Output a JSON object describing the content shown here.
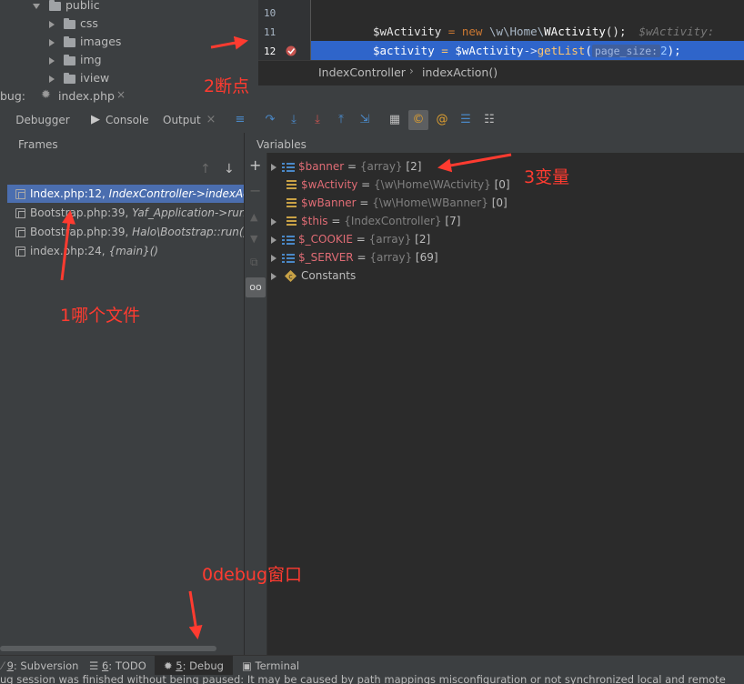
{
  "project_tree": {
    "items": [
      {
        "label": "public",
        "expanded": true
      },
      {
        "label": "css"
      },
      {
        "label": "images"
      },
      {
        "label": "img"
      },
      {
        "label": "iview"
      }
    ]
  },
  "editor": {
    "lines": [
      {
        "number": "10",
        "code": ""
      },
      {
        "number": "11",
        "code_var": "$wActivity",
        "code_op": " = ",
        "code_kw": "new",
        "code_rest": " \\w\\Home\\",
        "code_cls": "WActivity",
        "code_end": "();",
        "hint": "$wActivity:"
      },
      {
        "number": "12",
        "code_var": "$activity",
        "code_op": " = ",
        "code_var2": "$wActivity",
        "code_arrow": "->",
        "code_fn": "getList",
        "code_paren": "(",
        "param_hint": "page_size:",
        "code_arg": "2",
        "code_close": ");"
      }
    ],
    "breadcrumb": [
      "IndexController",
      "indexAction()"
    ]
  },
  "debug_bar": {
    "label": "bug:",
    "tab": "index.php"
  },
  "tabs": {
    "debugger": "Debugger",
    "console": "Console",
    "output": "Output"
  },
  "frames": {
    "title": "Frames",
    "rows": [
      {
        "file": "Index.php:12,",
        "call": "IndexController->indexAct",
        "selected": true
      },
      {
        "file": "Bootstrap.php:39,",
        "call": "Yaf_Application->run("
      },
      {
        "file": "Bootstrap.php:39,",
        "call": "Halo\\Bootstrap::run()"
      },
      {
        "file": "index.php:24,",
        "call": "{main}()"
      }
    ]
  },
  "variables": {
    "title": "Variables",
    "rows": [
      {
        "name": "$banner",
        "type": "{array}",
        "count": "[2]",
        "expandable": true,
        "kind": "array"
      },
      {
        "name": "$wActivity",
        "type": "{\\w\\Home\\WActivity}",
        "count": "[0]",
        "expandable": false,
        "kind": "object"
      },
      {
        "name": "$wBanner",
        "type": "{\\w\\Home\\WBanner}",
        "count": "[0]",
        "expandable": false,
        "kind": "object"
      },
      {
        "name": "$this",
        "type": "{IndexController}",
        "count": "[7]",
        "expandable": true,
        "kind": "object"
      },
      {
        "name": "$_COOKIE",
        "type": "{array}",
        "count": "[2]",
        "expandable": true,
        "kind": "array"
      },
      {
        "name": "$_SERVER",
        "type": "{array}",
        "count": "[69]",
        "expandable": true,
        "kind": "array"
      },
      {
        "name": "Constants",
        "type": "",
        "count": "",
        "expandable": true,
        "kind": "const"
      }
    ]
  },
  "annotations": {
    "breakpoint": "2断点",
    "variables": "3变量",
    "file": "1哪个文件",
    "window": "0debug窗口"
  },
  "bottom_tabs": [
    {
      "num": "9",
      "label": ": Subversion"
    },
    {
      "num": "6",
      "label": ": TODO"
    },
    {
      "num": "5",
      "label": ": Debug",
      "active": true
    },
    {
      "num": "",
      "label": "Terminal"
    }
  ],
  "status_text": "ug session was finished without being paused: It may be caused by path mappings misconfiguration or not synchronized local and remote",
  "colors": {
    "accent": "#4b6eaf",
    "annotation": "#ff3b30",
    "var_name": "#e06c75"
  }
}
